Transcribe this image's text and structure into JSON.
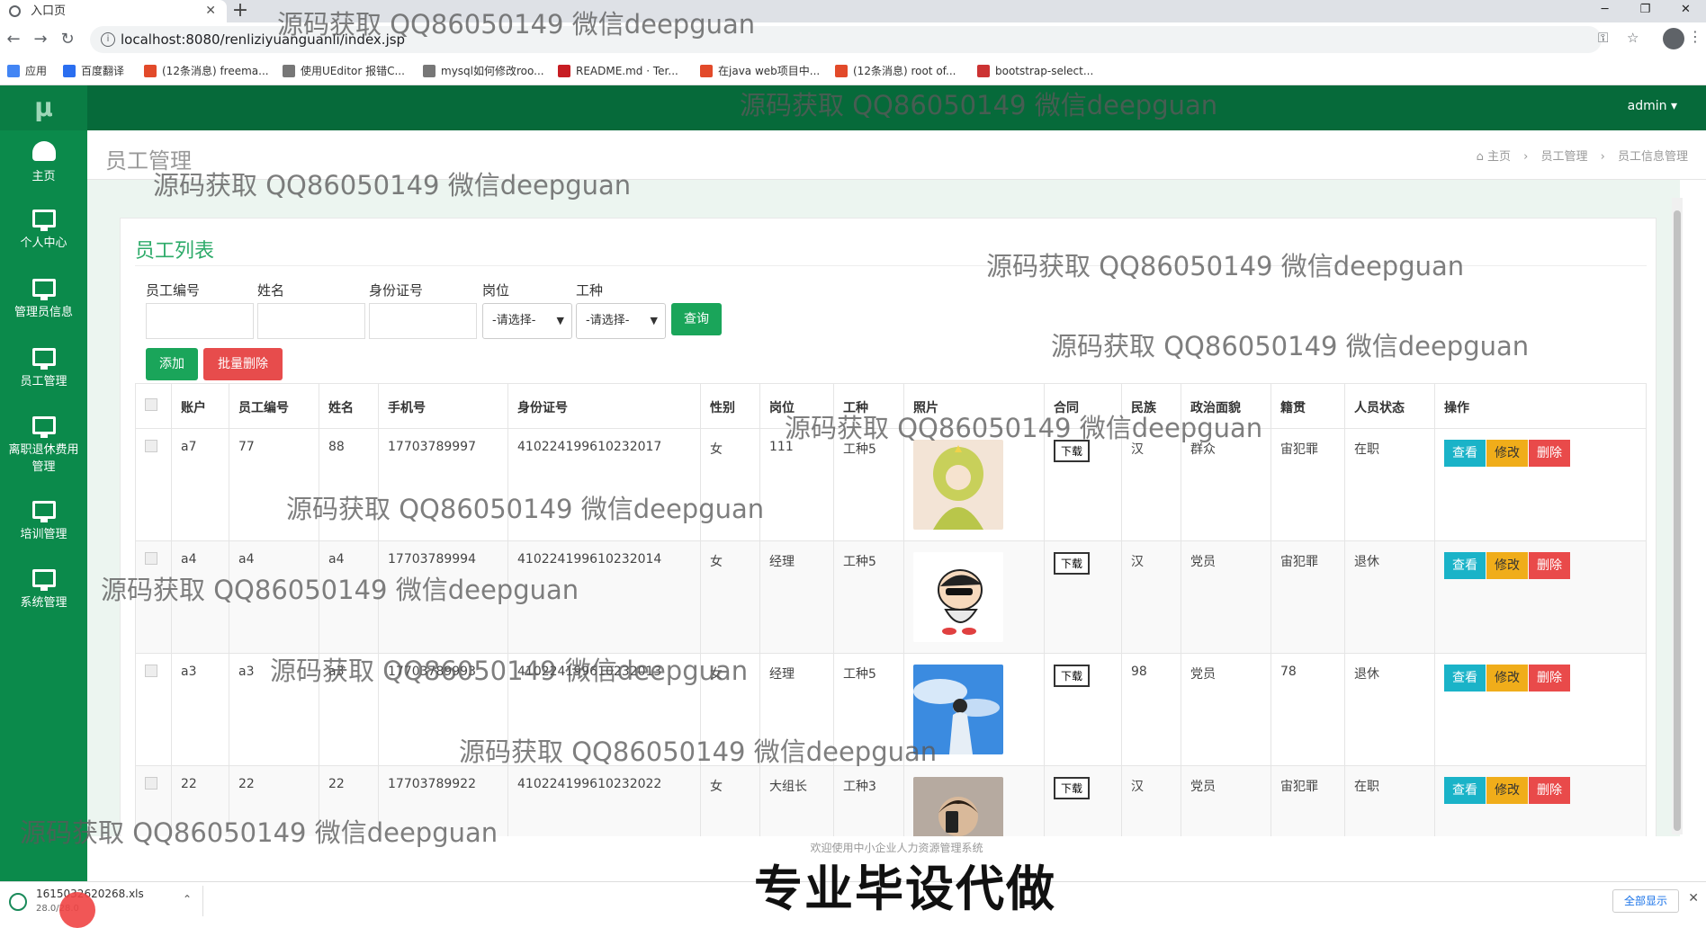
{
  "browser": {
    "tab_title": "入口页",
    "url": "localhost:8080/renliziyuanguanli/index.jsp",
    "bookmarks": [
      {
        "label": "应用",
        "color": "#4285f4"
      },
      {
        "label": "百度翻译",
        "color": "#2a6ef0"
      },
      {
        "label": "(12条消息) freema...",
        "color": "#e24a2a"
      },
      {
        "label": "使用UEditor 报错C...",
        "color": "#555555"
      },
      {
        "label": "mysql如何修改roo...",
        "color": "#555555"
      },
      {
        "label": "README.md · Ter...",
        "color": "#c71d23"
      },
      {
        "label": "在java web项目中...",
        "color": "#e24a2a"
      },
      {
        "label": "(12条消息) root of...",
        "color": "#e24a2a"
      },
      {
        "label": "bootstrap-select...",
        "color": "#c33"
      }
    ]
  },
  "app": {
    "logo": "μ",
    "user": "admin",
    "sidebar": [
      {
        "label": "主页",
        "icon": "dashboard-icon"
      },
      {
        "label": "个人中心",
        "icon": "monitor-icon"
      },
      {
        "label": "管理员信息",
        "icon": "monitor-icon"
      },
      {
        "label": "员工管理",
        "icon": "monitor-icon"
      },
      {
        "label": "离职退休费用管理",
        "icon": "monitor-icon"
      },
      {
        "label": "培训管理",
        "icon": "monitor-icon"
      },
      {
        "label": "系统管理",
        "icon": "monitor-icon"
      }
    ],
    "page_title": "员工管理",
    "breadcrumbs": [
      "主页",
      "员工管理",
      "员工信息管理"
    ]
  },
  "panel": {
    "title": "员工列表",
    "filters": {
      "employee_no_label": "员工编号",
      "name_label": "姓名",
      "id_card_label": "身份证号",
      "post_label": "岗位",
      "work_type_label": "工种",
      "post_value": "-请选择-",
      "work_type_value": "-请选择-",
      "query_button": "查询"
    },
    "add_button": "添加",
    "batch_delete_button": "批量删除"
  },
  "table": {
    "columns": [
      "账户",
      "员工编号",
      "姓名",
      "手机号",
      "身份证号",
      "性别",
      "岗位",
      "工种",
      "照片",
      "合同",
      "民族",
      "政治面貌",
      "籍贯",
      "人员状态",
      "操作"
    ],
    "download_label": "下载",
    "view_label": "查看",
    "edit_label": "修改",
    "delete_label": "删除",
    "rows": [
      {
        "account": "a7",
        "emp_no": "77",
        "name": "88",
        "phone": "17703789997",
        "id_card": "410224199610232017",
        "gender": "女",
        "post": "111",
        "work_type": "工种5",
        "photo": "girl",
        "ethnicity": "汉",
        "political": "群众",
        "native": "宙犯罪",
        "status": "在职"
      },
      {
        "account": "a4",
        "emp_no": "a4",
        "name": "a4",
        "phone": "17703789994",
        "id_card": "410224199610232014",
        "gender": "女",
        "post": "经理",
        "work_type": "工种5",
        "photo": "cartoon",
        "ethnicity": "汉",
        "political": "党员",
        "native": "宙犯罪",
        "status": "退休"
      },
      {
        "account": "a3",
        "emp_no": "a3",
        "name": "a3",
        "phone": "17703789993",
        "id_card": "410224199610232013",
        "gender": "女",
        "post": "经理",
        "work_type": "工种5",
        "photo": "sky",
        "ethnicity": "98",
        "political": "党员",
        "native": "78",
        "status": "退休"
      },
      {
        "account": "22",
        "emp_no": "22",
        "name": "22",
        "phone": "17703789922",
        "id_card": "410224199610232022",
        "gender": "女",
        "post": "大组长",
        "work_type": "工种3",
        "photo": "man",
        "ethnicity": "汉",
        "political": "党员",
        "native": "宙犯罪",
        "status": "在职"
      }
    ]
  },
  "footer": "欢迎使用中小企业人力资源管理系统",
  "downloads": {
    "file_name": "1615032620268.xls",
    "file_size": "28.0/28.0",
    "show_all": "全部显示"
  },
  "overlay": {
    "watermark": "源码获取 QQ86050149 微信deepguan",
    "promo": "专业毕设代做"
  }
}
